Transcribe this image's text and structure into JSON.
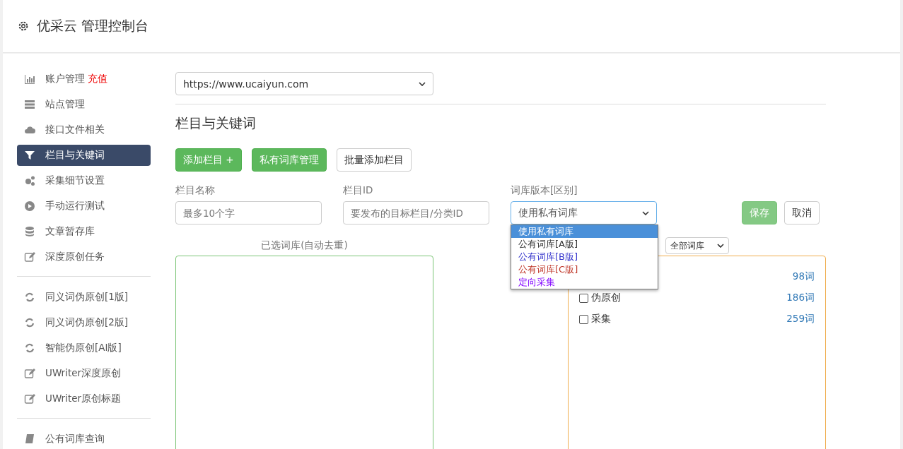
{
  "header": {
    "title": "优采云 管理控制台"
  },
  "sidebar": {
    "groups": [
      [
        {
          "label": "账户管理",
          "badge": "充值",
          "selected": false
        },
        {
          "label": "站点管理",
          "selected": false
        },
        {
          "label": "接口文件相关",
          "selected": false
        },
        {
          "label": "栏目与关键词",
          "selected": true
        },
        {
          "label": "采集细节设置",
          "selected": false
        },
        {
          "label": "手动运行测试",
          "selected": false
        },
        {
          "label": "文章暂存库",
          "selected": false
        },
        {
          "label": "深度原创任务",
          "selected": false
        }
      ],
      [
        {
          "label": "同义词伪原创[1版]",
          "selected": false
        },
        {
          "label": "同义词伪原创[2版]",
          "selected": false
        },
        {
          "label": "智能伪原创[AI版]",
          "selected": false
        },
        {
          "label": "UWriter深度原创",
          "selected": false
        },
        {
          "label": "UWriter原创标题",
          "selected": false
        }
      ],
      [
        {
          "label": "公有词库查询",
          "selected": false
        }
      ]
    ]
  },
  "site_select": {
    "value": "https://www.ucaiyun.com"
  },
  "section_title": "栏目与关键词",
  "buttons": [
    {
      "kind": "green",
      "label": "添加栏目 +"
    },
    {
      "kind": "green",
      "label": "私有词库管理"
    },
    {
      "kind": "plain",
      "label": "批量添加栏目"
    }
  ],
  "form": {
    "fields": [
      {
        "label": "栏目名称",
        "placeholder": "最多10个字"
      },
      {
        "label": "栏目ID",
        "placeholder": "要发布的目标栏目/分类ID"
      }
    ],
    "version": {
      "label": "词库版本[区别]",
      "value": "使用私有词库",
      "expanded": true,
      "options": [
        {
          "label": "使用私有词库",
          "selected": true
        },
        {
          "label": "公有词库[A版]",
          "selected": false,
          "color": "#333333"
        },
        {
          "label": "公有词库[B版]",
          "selected": false,
          "color": "#3333cc"
        },
        {
          "label": "公有词库[C版]",
          "selected": false,
          "color": "#c0392b"
        },
        {
          "label": "定向采集",
          "selected": false,
          "color": "#8000ff"
        }
      ]
    },
    "save": "保存",
    "cancel": "取消"
  },
  "selected_panel": {
    "label": "已选词库(自动去重)"
  },
  "library_panel": {
    "filter": "全部词库",
    "rows": [
      {
        "count": "98词"
      },
      {
        "label": "伪原创",
        "checked": false,
        "count": "186词"
      },
      {
        "label": "采集",
        "checked": false,
        "count": "259词"
      }
    ]
  }
}
